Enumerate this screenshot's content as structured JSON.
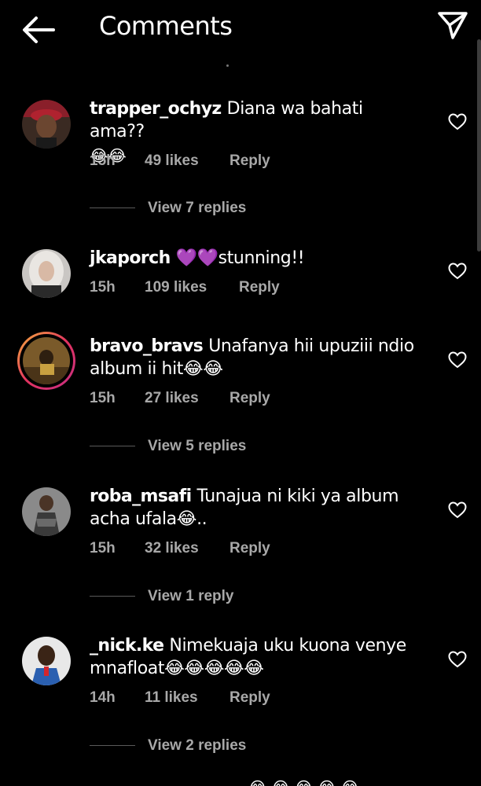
{
  "header": {
    "title": "Comments"
  },
  "comments": [
    {
      "username": "trapper_ochyz",
      "text": "Diana wa bahati ama??",
      "emojis": "😂😂",
      "time": "15h",
      "likes": "49 likes",
      "reply": "Reply",
      "view_replies": "View 7 replies"
    },
    {
      "username": "jkaporch",
      "text": "💜💜stunning!!",
      "time": "15h",
      "likes": "109 likes",
      "reply": "Reply"
    },
    {
      "username": "bravo_bravs",
      "text": "Unafanya hii upuziii ndio album ii hit😂😂",
      "time": "15h",
      "likes": "27 likes",
      "reply": "Reply",
      "view_replies": "View 5 replies"
    },
    {
      "username": "roba_msafi",
      "text": "Tunajua ni kiki ya album acha ufala😂..",
      "time": "15h",
      "likes": "32 likes",
      "reply": "Reply",
      "view_replies": "View 1 reply"
    },
    {
      "username": "_nick.ke",
      "text": "Nimekuaja uku kuona venye mnafloat😂😂😂😂😂",
      "time": "14h",
      "likes": "11 likes",
      "reply": "Reply",
      "view_replies": "View 2 replies"
    }
  ],
  "bottom_emojis": "😂😂😂😂😂",
  "colors": {
    "background": "#000000",
    "text": "#ffffff",
    "muted": "#a8a8a8",
    "story_ring": "#e2335f"
  },
  "icons": {
    "back": "arrow-left-icon",
    "share": "paper-plane-icon",
    "like": "heart-outline-icon"
  }
}
